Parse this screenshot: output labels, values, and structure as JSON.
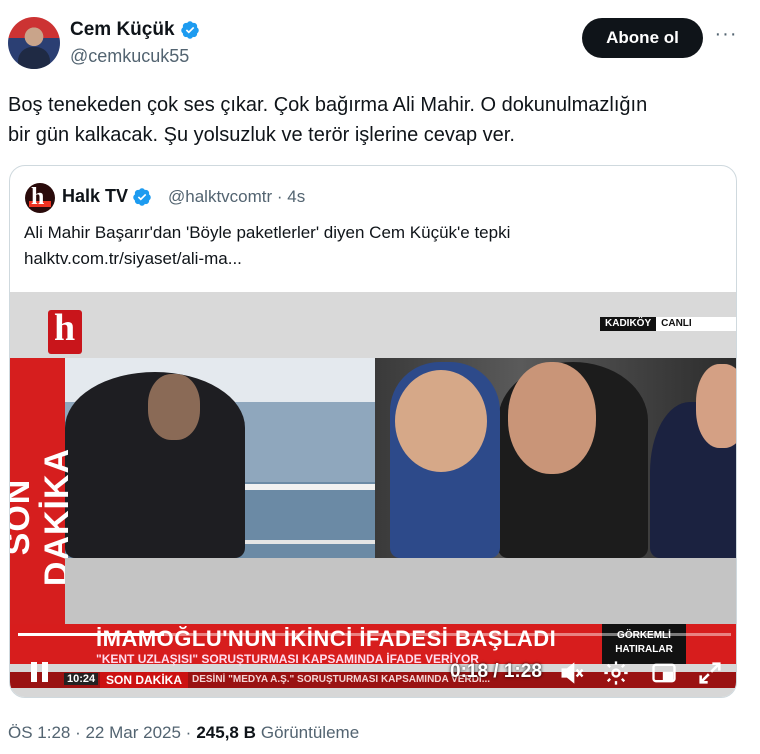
{
  "author": {
    "name": "Cem Küçük",
    "handle": "@cemkucuk55",
    "verified_color": "#1d9bf0"
  },
  "actions": {
    "follow_label": "Abone ol",
    "more_icon": "more-horizontal-icon"
  },
  "tweet": {
    "line1": "Boş tenekeden çok ses çıkar. Çok bağırma Ali Mahir. O dokunulmazlığın",
    "line2": "bir gün kalkacak. Şu yolsuzluk ve terör işlerine cevap ver."
  },
  "quoted": {
    "name": "Halk TV",
    "handle": "@halktvcomtr",
    "time": "· 4s",
    "text": "Ali Mahir Başarır'dan 'Böyle paketlerler' diyen Cem Küçük'e tepki",
    "link": "halktv.com.tr/siyaset/ali-ma..."
  },
  "video": {
    "location_tag": "KADIKÖY",
    "live_tag": "CANLI",
    "side_banner": "SON DAKİKA",
    "headline": "İMAMOĞLU'NUN İKİNCİ İFADESİ BAŞLADI",
    "subline": "\"KENT UZLAŞISI\" SORUŞTURMASI KAPSAMINDA İFADE VERİYOR",
    "promo_line1": "GÖRKEMLİ",
    "promo_line2": "HATIRALAR",
    "ticker_clock": "10:24",
    "ticker_label": "SON DAKİKA",
    "ticker_text": "DESİNİ \"MEDYA A.Ş.\" SORUŞTURMASI KAPSAMINDA VERDİ...",
    "time_display": "0:18 / 1:28",
    "progress_fraction": 0.2045,
    "accent_red": "#d71d1d"
  },
  "footer": {
    "timestamp": "ÖS 1:28 · 22 Mar 2025 ·",
    "views_count": "245,8 B",
    "views_label": "Görüntüleme"
  }
}
